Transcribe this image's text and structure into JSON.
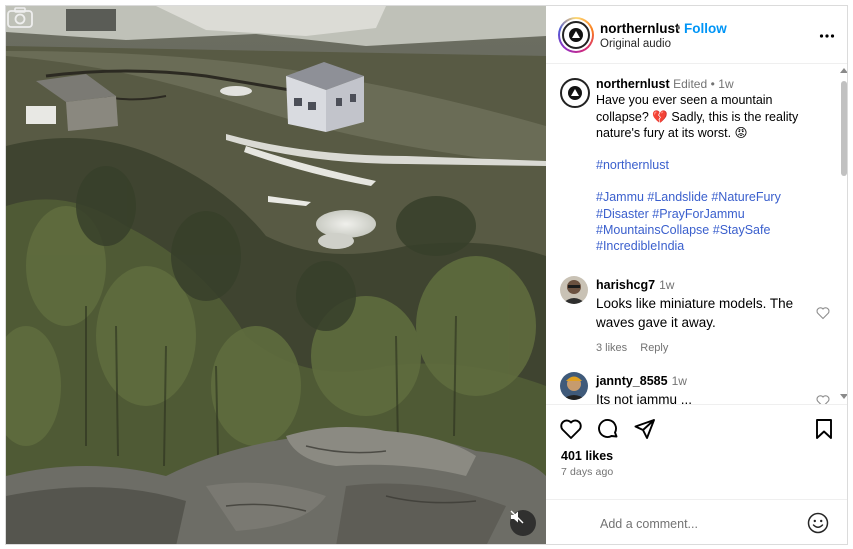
{
  "post": {
    "username": "northernlust",
    "follow_label": "Follow",
    "separator": "•",
    "audio_label": "Original audio"
  },
  "caption": {
    "username": "northernlust",
    "edited": "Edited",
    "separator": "•",
    "time": "1w",
    "line1": "Have you ever seen a mountain",
    "line2": "collapse? 💔 Sadly, this is the reality",
    "line3": "nature's fury at its worst. 😡",
    "tag_main": "#northernlust",
    "tags_line1": "#Jammu #Landslide #NatureFury",
    "tags_line2": "#Disaster #PrayForJammu",
    "tags_line3": "#MountainsCollapse #StaySafe",
    "tags_line4": "#IncredibleIndia"
  },
  "comments": [
    {
      "username": "harishcg7",
      "time": "1w",
      "text": "Looks like miniature models. The waves gave it away.",
      "likes": "3 likes",
      "reply": "Reply"
    },
    {
      "username": "jannty_8585",
      "time": "1w",
      "text": "Its not jammu ..."
    }
  ],
  "stats": {
    "likes": "401 likes",
    "date": "7 days ago"
  },
  "comment_box": {
    "placeholder": "Add a comment..."
  },
  "icons": {
    "more": "more-options-icon",
    "like": "heart-icon",
    "comment": "comment-icon",
    "share": "share-icon",
    "save": "bookmark-icon",
    "emoji": "emoji-icon",
    "mute": "muted-speaker-icon",
    "camera": "camera-icon"
  },
  "colors": {
    "follow": "#0095f6",
    "hashtag": "#3a5fcd",
    "muted_text": "#737373"
  }
}
